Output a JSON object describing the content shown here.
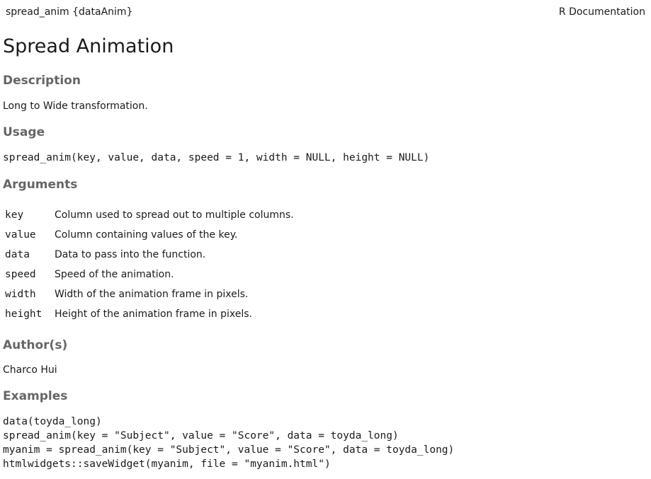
{
  "header": {
    "left": "spread_anim {dataAnim}",
    "right": "R Documentation"
  },
  "title": "Spread Animation",
  "description": {
    "heading": "Description",
    "text": "Long to Wide transformation."
  },
  "usage": {
    "heading": "Usage",
    "code": "spread_anim(key, value, data, speed = 1, width = NULL, height = NULL)"
  },
  "arguments": {
    "heading": "Arguments",
    "items": [
      {
        "name": "key",
        "desc": "Column used to spread out to multiple columns."
      },
      {
        "name": "value",
        "desc": "Column containing values of the key."
      },
      {
        "name": "data",
        "desc": "Data to pass into the function."
      },
      {
        "name": "speed",
        "desc": "Speed of the animation."
      },
      {
        "name": "width",
        "desc": "Width of the animation frame in pixels."
      },
      {
        "name": "height",
        "desc": "Height of the animation frame in pixels."
      }
    ]
  },
  "authors": {
    "heading": "Author(s)",
    "text": "Charco Hui"
  },
  "examples": {
    "heading": "Examples",
    "lines": [
      "data(toyda_long)",
      "spread_anim(key = \"Subject\", value = \"Score\", data = toyda_long)",
      "myanim = spread_anim(key = \"Subject\", value = \"Score\", data = toyda_long)",
      "htmlwidgets::saveWidget(myanim, file = \"myanim.html\")"
    ]
  }
}
